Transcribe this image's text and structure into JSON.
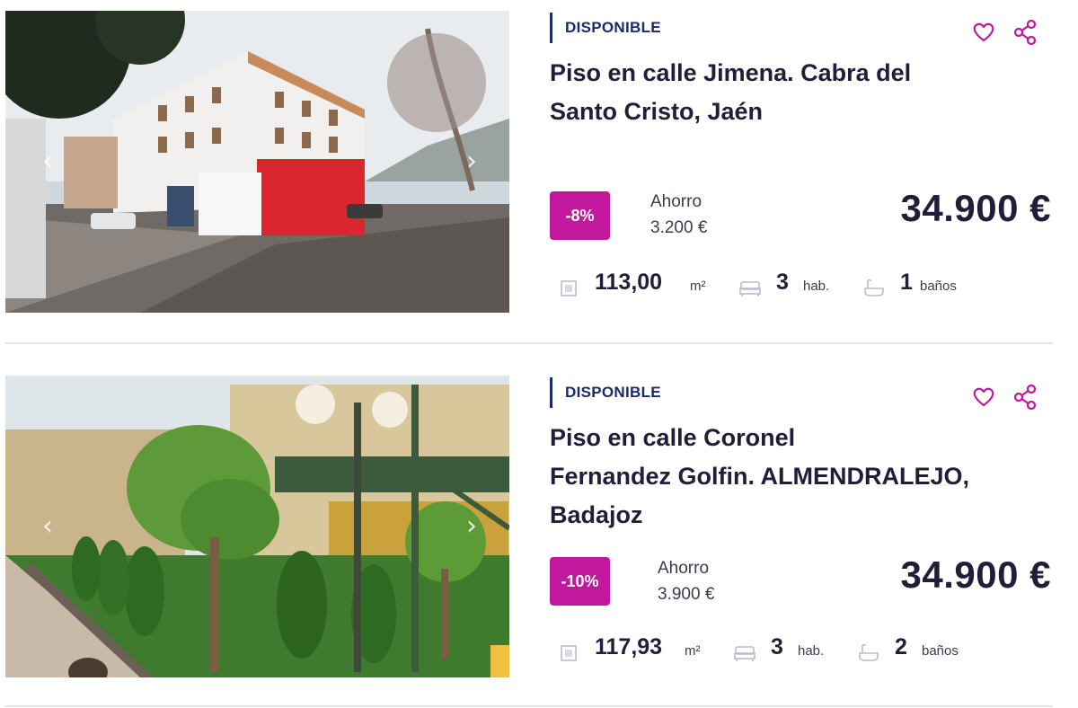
{
  "listings": [
    {
      "status": "DISPONIBLE",
      "title_line1": "Piso en calle Jimena. Cabra del",
      "title_line2": "Santo Cristo, Jaén",
      "title_line3": "",
      "discount": "-8%",
      "saving_label": "Ahorro",
      "saving_amount": "3.200 €",
      "price": "34.900 €",
      "area": "113,00",
      "area_unit": "m²",
      "rooms": "3",
      "rooms_unit": "hab.",
      "baths": "1",
      "baths_unit": "baños"
    },
    {
      "status": "DISPONIBLE",
      "title_line1": "Piso en calle Coronel",
      "title_line2": "Fernandez Golfin. ALMENDRALEJO,",
      "title_line3": "Badajoz",
      "discount": "-10%",
      "saving_label": "Ahorro",
      "saving_amount": "3.900 €",
      "price": "34.900 €",
      "area": "117,93",
      "area_unit": "m²",
      "rooms": "3",
      "rooms_unit": "hab.",
      "baths": "2",
      "baths_unit": "baños"
    }
  ],
  "icons": {
    "favorite": "heart-icon",
    "share": "share-icon",
    "area": "area-icon",
    "rooms": "bed-icon",
    "baths": "bathtub-icon",
    "prev": "chevron-left-icon",
    "next": "chevron-right-icon"
  },
  "arrows": {
    "prev": "‹",
    "next": "›"
  },
  "colors": {
    "accent": "#c2189c",
    "status": "#1b2a6b",
    "text": "#1f1f3a"
  }
}
